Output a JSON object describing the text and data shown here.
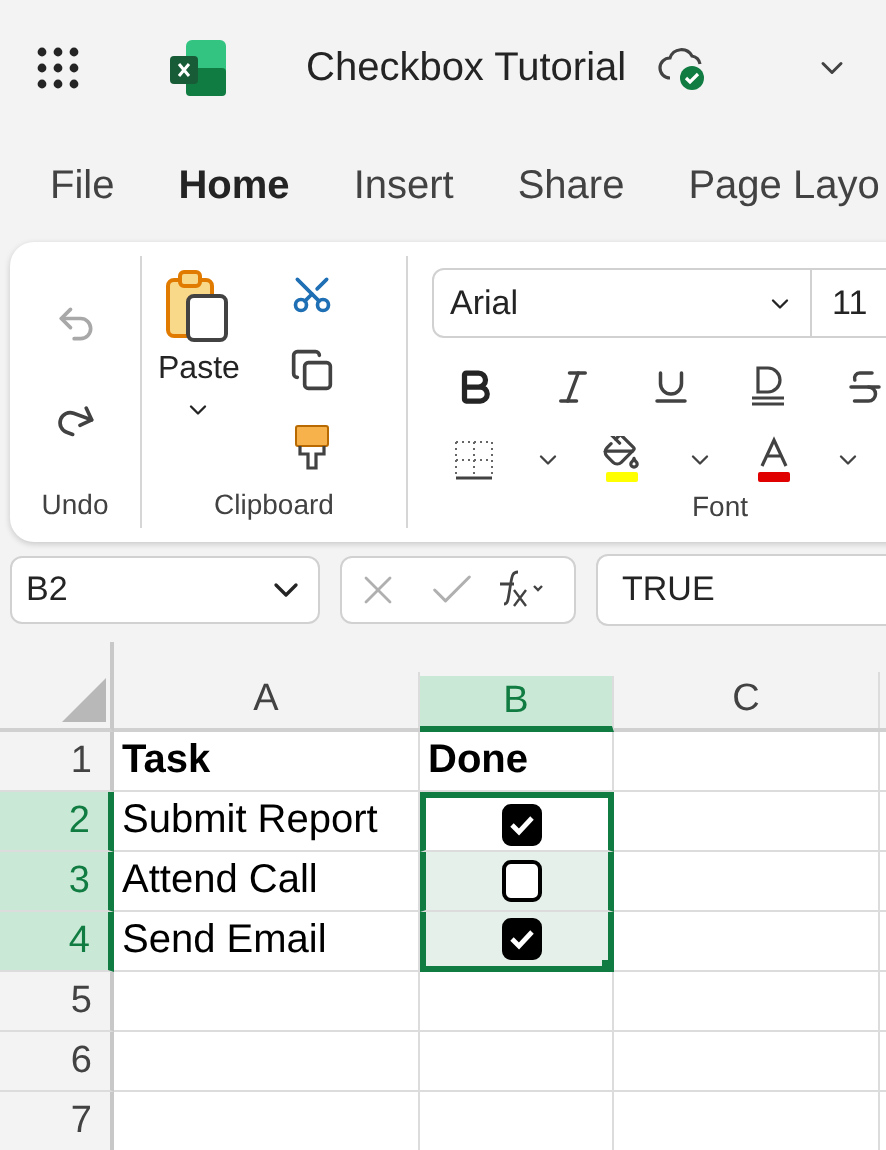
{
  "window": {
    "title": "Checkbox Tutorial"
  },
  "tabs": [
    {
      "label": "File",
      "selected": false
    },
    {
      "label": "Home",
      "selected": true
    },
    {
      "label": "Insert",
      "selected": false
    },
    {
      "label": "Share",
      "selected": false
    },
    {
      "label": "Page Layo",
      "selected": false
    }
  ],
  "ribbon": {
    "undo_group": {
      "label": "Undo"
    },
    "clipboard_group": {
      "label": "Clipboard",
      "paste": "Paste"
    },
    "font_group": {
      "label": "Font",
      "font_name": "Arial",
      "font_size": "11"
    }
  },
  "formula_bar": {
    "name_box": "B2",
    "formula": "TRUE"
  },
  "sheet": {
    "columns": [
      {
        "label": "A",
        "selected": false
      },
      {
        "label": "B",
        "selected": true
      },
      {
        "label": "C",
        "selected": false
      }
    ],
    "rows": [
      {
        "number": "1",
        "selected": false,
        "cells": [
          {
            "kind": "text",
            "text": "Task",
            "bold": true,
            "selected": false,
            "active": false
          },
          {
            "kind": "text",
            "text": "Done",
            "bold": true,
            "selected": false,
            "active": false
          }
        ]
      },
      {
        "number": "2",
        "selected": true,
        "cells": [
          {
            "kind": "text",
            "text": "Submit Report",
            "bold": false,
            "selected": false,
            "active": false
          },
          {
            "kind": "checkbox",
            "checked": true,
            "selected": true,
            "active": true
          }
        ]
      },
      {
        "number": "3",
        "selected": true,
        "cells": [
          {
            "kind": "text",
            "text": "Attend Call",
            "bold": false,
            "selected": false,
            "active": false
          },
          {
            "kind": "checkbox",
            "checked": false,
            "selected": true,
            "active": false
          }
        ]
      },
      {
        "number": "4",
        "selected": true,
        "cells": [
          {
            "kind": "text",
            "text": "Send Email",
            "bold": false,
            "selected": false,
            "active": false
          },
          {
            "kind": "checkbox",
            "checked": true,
            "selected": true,
            "active": false
          }
        ]
      },
      {
        "number": "5",
        "selected": false
      },
      {
        "number": "6",
        "selected": false
      },
      {
        "number": "7",
        "selected": false
      }
    ]
  }
}
